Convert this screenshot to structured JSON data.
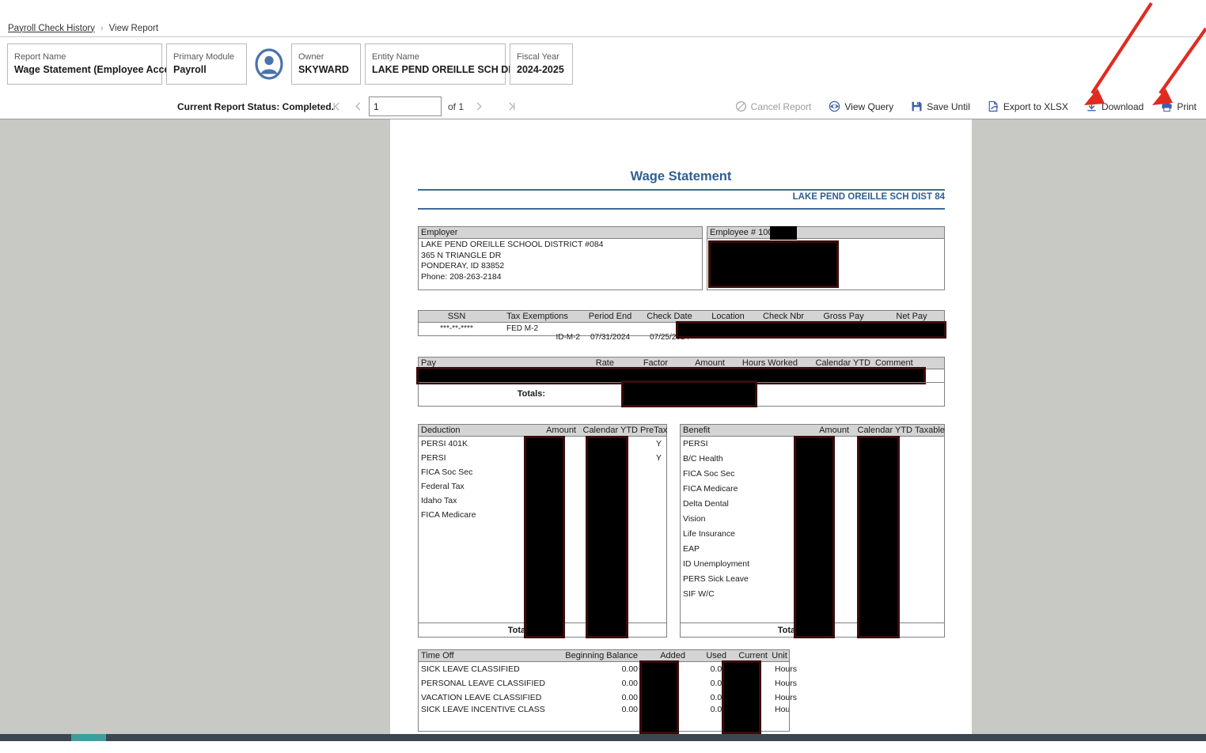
{
  "breadcrumb": {
    "root": "Payroll Check History",
    "separator": "›",
    "current": "View Report"
  },
  "header_cards": {
    "report_name": {
      "label": "Report Name",
      "value": "Wage Statement (Employee Access)"
    },
    "primary_module": {
      "label": "Primary Module",
      "value": "Payroll"
    },
    "owner": {
      "label": "Owner",
      "value": "SKYWARD"
    },
    "entity_name": {
      "label": "Entity Name",
      "value": "LAKE PEND OREILLE SCH DIS..."
    },
    "fiscal_year": {
      "label": "Fiscal Year",
      "value": "2024-2025"
    },
    "avatar_icon": "user-avatar-icon"
  },
  "toolbar": {
    "status": "Current Report Status: Completed.",
    "page_value": "1",
    "page_of": "of 1",
    "first_page_icon": "first-page-icon",
    "prev_page_icon": "prev-page-icon",
    "next_page_icon": "next-page-icon",
    "last_page_icon": "last-page-icon",
    "actions": [
      {
        "label": "Cancel Report",
        "icon": "cancel-icon",
        "disabled": true
      },
      {
        "label": "View Query",
        "icon": "eye-icon",
        "disabled": false
      },
      {
        "label": "Save Until",
        "icon": "save-disk-icon",
        "disabled": false
      },
      {
        "label": "Export to XLSX",
        "icon": "export-icon",
        "disabled": false
      },
      {
        "label": "Download",
        "icon": "download-icon",
        "disabled": false
      },
      {
        "label": "Print",
        "icon": "printer-icon",
        "disabled": false
      }
    ]
  },
  "report": {
    "title": "Wage Statement",
    "entity_line": "LAKE PEND OREILLE SCH DIST 84",
    "employer": {
      "header": "Employer",
      "lines": [
        "LAKE PEND OREILLE SCHOOL DISTRICT #084",
        "365 N TRIANGLE DR",
        "PONDERAY, ID 83852",
        "Phone: 208-263-2184"
      ]
    },
    "employee": {
      "header": "Employee # 100",
      "redacted": true
    },
    "check_info": {
      "columns": [
        "SSN",
        "Tax Exemptions",
        "Period End",
        "Check Date",
        "Location",
        "Check Nbr",
        "Gross Pay",
        "Net Pay"
      ],
      "row": {
        "ssn": "***-**-****",
        "fed_exemption": "FED M-2",
        "state_exemption": "ID-M-2",
        "period_end": "07/31/2024",
        "check_date": "07/25/2024",
        "location": "",
        "check_nbr": "",
        "gross_pay": "",
        "net_pay": ""
      }
    },
    "pay": {
      "columns": [
        "Pay",
        "Rate",
        "Factor",
        "Amount",
        "Hours Worked",
        "Calendar YTD",
        "Comment"
      ],
      "totals_label": "Totals:"
    },
    "deduction": {
      "columns": [
        "Deduction",
        "Amount",
        "Calendar YTD",
        "PreTax"
      ],
      "rows": [
        {
          "name": "PERSI 401K",
          "amount": "",
          "calendar_ytd": "",
          "pretax": "Y"
        },
        {
          "name": "PERSI",
          "amount": "",
          "calendar_ytd": "",
          "pretax": "Y"
        },
        {
          "name": "FICA Soc Sec",
          "amount": "",
          "calendar_ytd": "",
          "pretax": ""
        },
        {
          "name": "Federal Tax",
          "amount": "",
          "calendar_ytd": "",
          "pretax": ""
        },
        {
          "name": "Idaho Tax",
          "amount": "",
          "calendar_ytd": "",
          "pretax": ""
        },
        {
          "name": "FICA Medicare",
          "amount": "",
          "calendar_ytd": "",
          "pretax": ""
        }
      ],
      "totals_label": "Totals:"
    },
    "benefit": {
      "columns": [
        "Benefit",
        "Amount",
        "Calendar YTD",
        "Taxable"
      ],
      "rows": [
        {
          "name": "PERSI"
        },
        {
          "name": "B/C Health"
        },
        {
          "name": "FICA Soc Sec"
        },
        {
          "name": "FICA Medicare"
        },
        {
          "name": "Delta Dental"
        },
        {
          "name": "Vision"
        },
        {
          "name": "Life Insurance"
        },
        {
          "name": "EAP"
        },
        {
          "name": "ID Unemployment"
        },
        {
          "name": "PERS Sick Leave"
        },
        {
          "name": "SIF W/C"
        }
      ],
      "totals_label": "Totals:"
    },
    "time_off": {
      "columns": [
        "Time Off",
        "Beginning Balance",
        "Added",
        "Used",
        "Current",
        "Unit"
      ],
      "rows": [
        {
          "name": "SICK LEAVE CLASSIFIED",
          "beginning_balance": "0.00",
          "added": "",
          "used": "0.00",
          "current": "",
          "unit": "Hours"
        },
        {
          "name": "PERSONAL LEAVE CLASSIFIED",
          "beginning_balance": "0.00",
          "added": "",
          "used": "0.00",
          "current": "",
          "unit": "Hours"
        },
        {
          "name": "VACATION LEAVE CLASSIFIED",
          "beginning_balance": "0.00",
          "added": "",
          "used": "0.00",
          "current": "",
          "unit": "Hours"
        },
        {
          "name": "SICK LEAVE INCENTIVE CLASS",
          "beginning_balance": "0.00",
          "added": "",
          "used": "0.00",
          "current": "",
          "unit": "Hours"
        }
      ]
    }
  },
  "annotations": {
    "arrow_color": "#e02b20",
    "arrows": [
      {
        "target": "Download",
        "name": "annotation-arrow-download"
      },
      {
        "target": "Print",
        "name": "annotation-arrow-print"
      }
    ]
  },
  "colors": {
    "accent_blue": "#2e5f92",
    "rule_blue": "#3d6c99",
    "viewer_bg": "#c8c8c4",
    "redaction": "#000000"
  }
}
